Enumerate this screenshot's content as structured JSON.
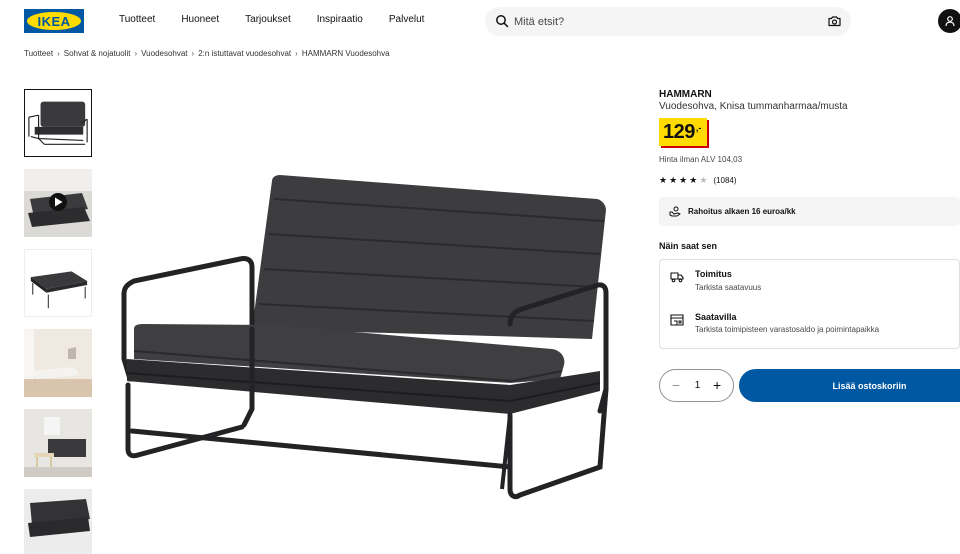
{
  "header": {
    "logo_text": "IKEA",
    "nav": [
      "Tuotteet",
      "Huoneet",
      "Tarjoukset",
      "Inspiraatio",
      "Palvelut"
    ],
    "search_placeholder": "Mitä etsit?"
  },
  "breadcrumb": [
    "Tuotteet",
    "Sohvat & nojatuolit",
    "Vuodesohvat",
    "2:n istuttavat vuodesohvat",
    "HAMMARN Vuodesohva"
  ],
  "product": {
    "name": "HAMMARN",
    "description": "Vuodesohva, Knisa tummanharmaa/musta",
    "price_main": "129",
    "price_suffix": ",-",
    "price_vat": "Hinta ilman ALV 104,03",
    "rating_stars": 4,
    "rating_max": 5,
    "rating_count": "(1084)",
    "financing": "Rahoitus alkaen 16 euroa/kk"
  },
  "availability": {
    "title": "Näin saat sen",
    "delivery_title": "Toimitus",
    "delivery_sub": "Tarkista saatavuus",
    "store_title": "Saatavilla",
    "store_sub": "Tarkista toimipisteen varastosaldo ja poimintapaikka"
  },
  "purchase": {
    "quantity": "1",
    "minus": "−",
    "plus": "+",
    "add_to_cart": "Lisää ostoskoriin"
  },
  "colors": {
    "brand_blue": "#0058a3",
    "brand_yellow": "#ffdb00",
    "price_shadow": "#cc0008"
  }
}
